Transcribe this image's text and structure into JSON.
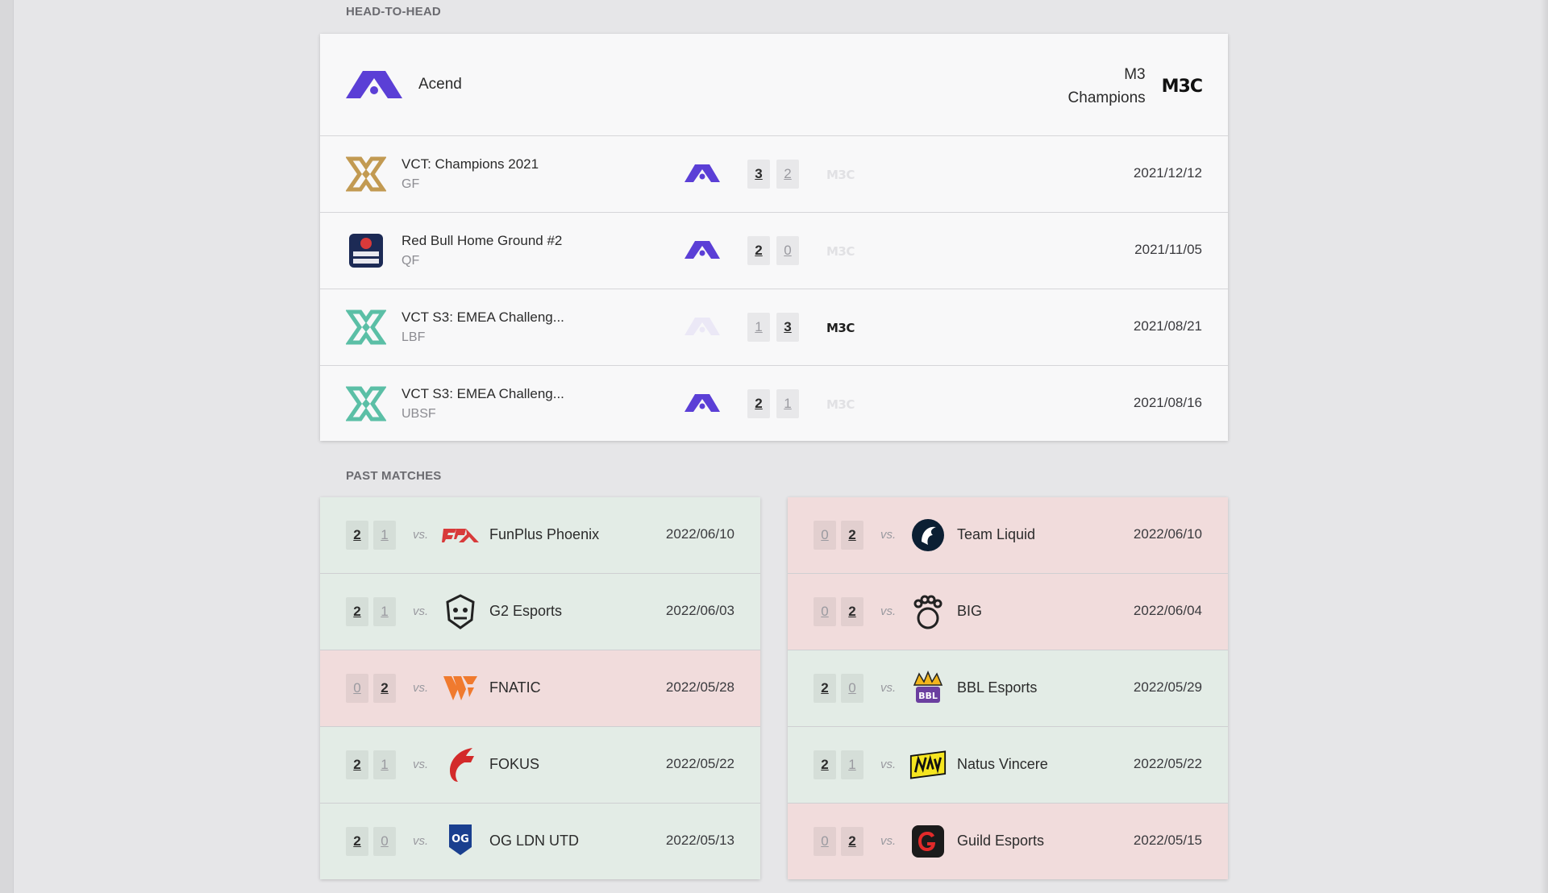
{
  "head_to_head": {
    "title": "HEAD-TO-HEAD",
    "team_a": {
      "name": "Acend",
      "logo_icon": "acend-logo-icon",
      "color": "#5b3fd6"
    },
    "team_b": {
      "name": "M3\nChampions",
      "logo_text": "M3C"
    },
    "matches": [
      {
        "event": "VCT: Champions 2021",
        "stage": "GF",
        "icon": "vct-champions-icon",
        "score_a": "3",
        "score_b": "2",
        "winner": "a",
        "date": "2021/12/12"
      },
      {
        "event": "Red Bull Home Ground #2",
        "stage": "QF",
        "icon": "red-bull-home-ground-icon",
        "score_a": "2",
        "score_b": "0",
        "winner": "a",
        "date": "2021/11/05"
      },
      {
        "event": "VCT S3: EMEA Challeng...",
        "stage": "LBF",
        "icon": "vct-challengers-icon",
        "score_a": "1",
        "score_b": "3",
        "winner": "b",
        "date": "2021/08/21"
      },
      {
        "event": "VCT S3: EMEA Challeng...",
        "stage": "UBSF",
        "icon": "vct-challengers-icon",
        "score_a": "2",
        "score_b": "1",
        "winner": "a",
        "date": "2021/08/16"
      }
    ]
  },
  "past_matches": {
    "title": "PAST MATCHES",
    "vs_label": "vs.",
    "left": [
      {
        "score_a": "2",
        "score_b": "1",
        "result": "win",
        "opponent": "FunPlus Phoenix",
        "icon": "fpx-logo-icon",
        "date": "2022/06/10"
      },
      {
        "score_a": "2",
        "score_b": "1",
        "result": "win",
        "opponent": "G2 Esports",
        "icon": "g2-logo-icon",
        "date": "2022/06/03"
      },
      {
        "score_a": "0",
        "score_b": "2",
        "result": "loss",
        "opponent": "FNATIC",
        "icon": "fnatic-logo-icon",
        "date": "2022/05/28"
      },
      {
        "score_a": "2",
        "score_b": "1",
        "result": "win",
        "opponent": "FOKUS",
        "icon": "fokus-logo-icon",
        "date": "2022/05/22"
      },
      {
        "score_a": "2",
        "score_b": "0",
        "result": "win",
        "opponent": "OG LDN UTD",
        "icon": "og-logo-icon",
        "date": "2022/05/13"
      }
    ],
    "right": [
      {
        "score_a": "0",
        "score_b": "2",
        "result": "loss",
        "opponent": "Team Liquid",
        "icon": "team-liquid-logo-icon",
        "date": "2022/06/10"
      },
      {
        "score_a": "0",
        "score_b": "2",
        "result": "loss",
        "opponent": "BIG",
        "icon": "big-logo-icon",
        "date": "2022/06/04"
      },
      {
        "score_a": "2",
        "score_b": "0",
        "result": "win",
        "opponent": "BBL Esports",
        "icon": "bbl-logo-icon",
        "date": "2022/05/29"
      },
      {
        "score_a": "2",
        "score_b": "1",
        "result": "win",
        "opponent": "Natus Vincere",
        "icon": "navi-logo-icon",
        "date": "2022/05/22"
      },
      {
        "score_a": "0",
        "score_b": "2",
        "result": "loss",
        "opponent": "Guild Esports",
        "icon": "guild-logo-icon",
        "date": "2022/05/15"
      }
    ]
  },
  "colors": {
    "acend": "#5b3fd6",
    "win_bg": "#e3ece6",
    "loss_bg": "#f1dcdc",
    "vct_gold": "#c29a52",
    "vct_teal": "#5bbfa6"
  }
}
